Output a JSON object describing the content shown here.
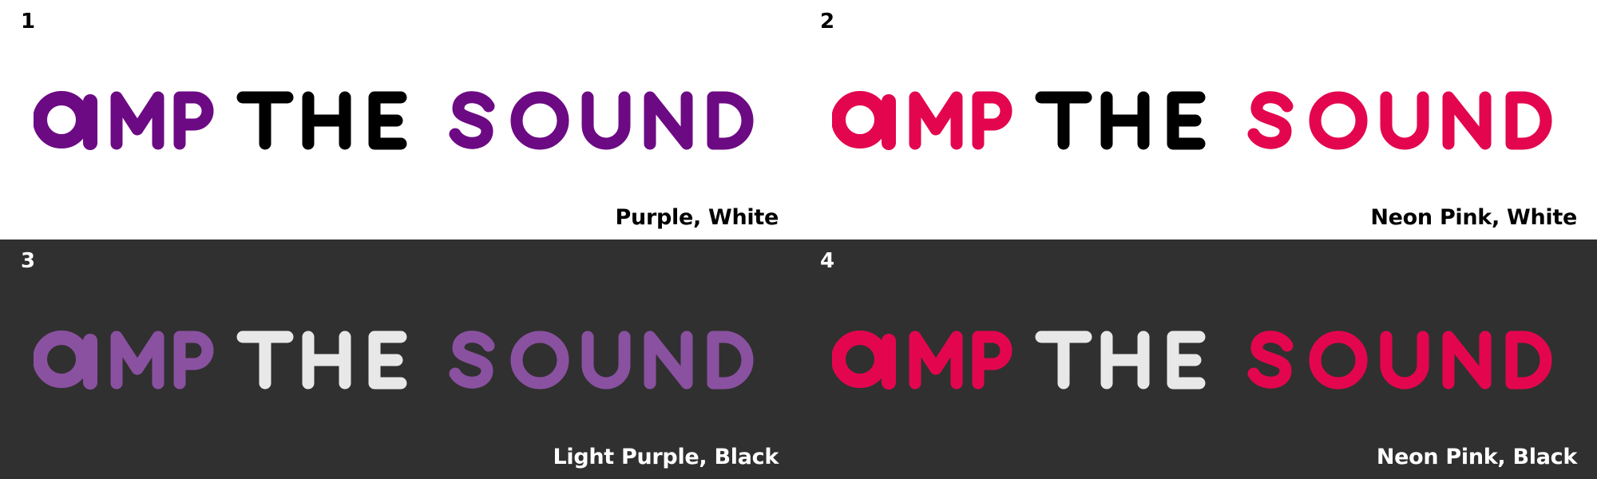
{
  "panels": [
    {
      "number": "1",
      "caption": "Purple, White",
      "logo_text": {
        "word1": "amp",
        "word2": "THE",
        "word3": "SOUND"
      },
      "colors": {
        "background": "#ffffff",
        "accent": "#6c0a83",
        "text": "#000000",
        "label": "#000000"
      }
    },
    {
      "number": "2",
      "caption": "Neon Pink, White",
      "logo_text": {
        "word1": "amp",
        "word2": "THE",
        "word3": "SOUND"
      },
      "colors": {
        "background": "#ffffff",
        "accent": "#e3064f",
        "text": "#000000",
        "label": "#000000"
      }
    },
    {
      "number": "3",
      "caption": "Light Purple, Black",
      "logo_text": {
        "word1": "amp",
        "word2": "THE",
        "word3": "SOUND"
      },
      "colors": {
        "background": "#303030",
        "accent": "#8a51a0",
        "text": "#e8e8e8",
        "label": "#ffffff"
      }
    },
    {
      "number": "4",
      "caption": "Neon Pink, Black",
      "logo_text": {
        "word1": "amp",
        "word2": "THE",
        "word3": "SOUND"
      },
      "colors": {
        "background": "#303030",
        "accent": "#e3064f",
        "text": "#e8e8e8",
        "label": "#ffffff"
      }
    }
  ]
}
